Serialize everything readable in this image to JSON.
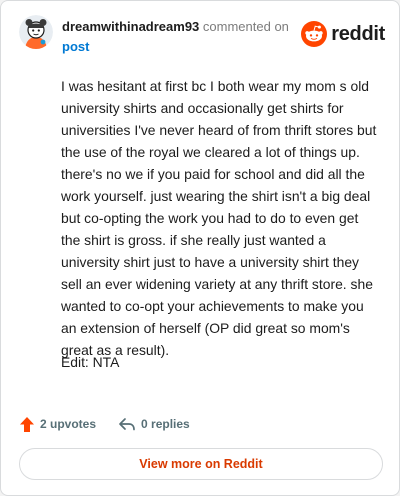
{
  "header": {
    "username": "dreamwithinadream93",
    "action_text": "commented on",
    "post_link": "post"
  },
  "brand": {
    "name": "reddit",
    "accent_color": "#ff4500"
  },
  "comment": {
    "body": "I was hesitant at first bc I both wear my mom s old university shirts and occasionally get shirts for universities I've never heard of from thrift stores but the use of the royal we cleared a lot of things up. there's no we if you paid for school and did all the work yourself. just wearing the shirt isn't a big deal but co-opting the work you had to do to even get the shirt is gross. if she really just wanted a university shirt just to have a university shirt they sell an ever widening variety at any thrift store. she wanted to co-opt your achievements to make you an extension of herself (OP did great so mom's great as a result).",
    "edit": "Edit: NTA"
  },
  "actions": {
    "upvotes_label": "2 upvotes",
    "replies_label": "0 replies",
    "upvote_icon": "upvote-arrow-icon",
    "reply_icon": "reply-arrow-icon"
  },
  "footer": {
    "view_more_label": "View more on Reddit"
  }
}
